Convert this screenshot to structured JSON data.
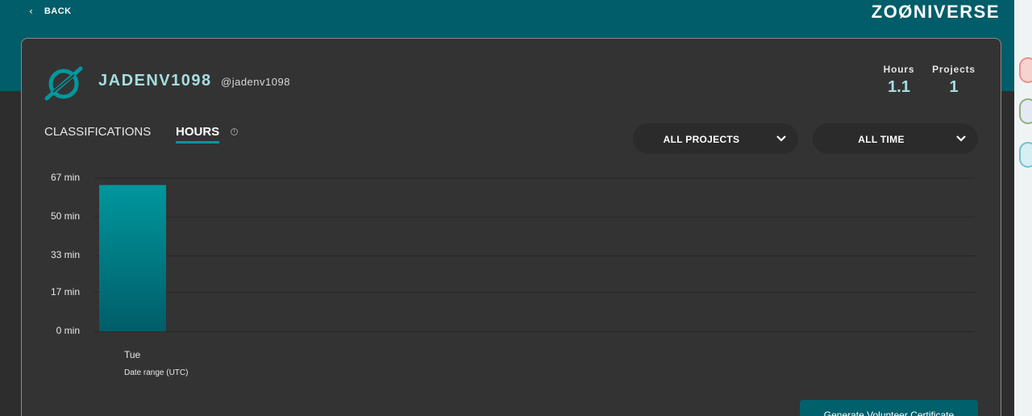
{
  "header": {
    "back_label": "BACK",
    "brand": "ZOØNIVERSE"
  },
  "profile": {
    "display_name": "JADENV1098",
    "handle": "@jadenv1098",
    "stats": [
      {
        "label": "Hours",
        "value": "1.1"
      },
      {
        "label": "Projects",
        "value": "1"
      }
    ]
  },
  "tabs": [
    {
      "label": "CLASSIFICATIONS",
      "active": false
    },
    {
      "label": "HOURS",
      "active": true
    }
  ],
  "filters": {
    "project": "ALL PROJECTS",
    "time": "ALL TIME"
  },
  "chart_data": {
    "type": "bar",
    "categories": [
      "Tue"
    ],
    "values": [
      64
    ],
    "y_ticks": [
      "67 min",
      "50 min",
      "33 min",
      "17 min",
      "0 min"
    ],
    "y_tick_values": [
      67,
      50,
      33,
      17,
      0
    ],
    "ylim": [
      0,
      67
    ],
    "xlabel": "Date range (UTC)",
    "ylabel": "",
    "grid": true,
    "bar_color_top": "#00979d",
    "bar_color_bottom": "#005d69"
  },
  "actions": {
    "certificate_label": "Generate Volunteer Certificate"
  },
  "colors": {
    "brand_teal": "#005d69",
    "accent": "#00979d",
    "card_bg": "#333333"
  },
  "icons": {
    "back": "chevron-left-icon",
    "info": "info-icon",
    "dropdown": "chevron-down-icon",
    "avatar": "zooniverse-logo-icon"
  }
}
